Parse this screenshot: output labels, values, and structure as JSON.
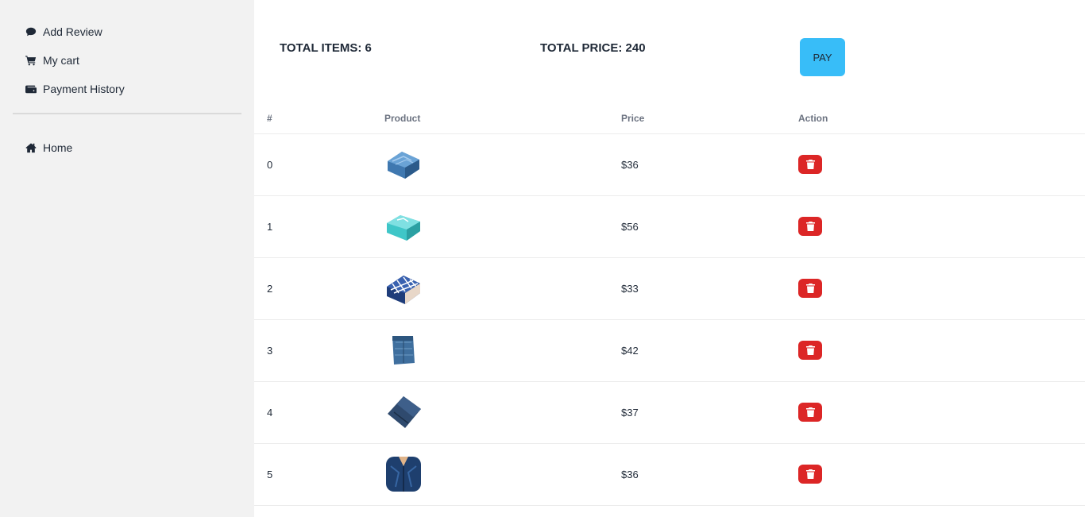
{
  "sidebar": {
    "primary": [
      {
        "label": "Add Review",
        "icon": "comment-icon"
      },
      {
        "label": "My cart",
        "icon": "cart-icon"
      },
      {
        "label": "Payment History",
        "icon": "wallet-icon"
      }
    ],
    "secondary": [
      {
        "label": "Home",
        "icon": "home-icon"
      }
    ]
  },
  "summary": {
    "total_items": "TOTAL ITEMS: 6",
    "total_price": "TOTAL PRICE: 240",
    "pay_label": "PAY"
  },
  "table": {
    "headers": [
      "#",
      "Product",
      "Price",
      "Action"
    ],
    "rows": [
      {
        "index": "0",
        "price": "$36",
        "image": "denim-shirt-folded"
      },
      {
        "index": "1",
        "price": "$56",
        "image": "aqua-shirt-folded"
      },
      {
        "index": "2",
        "price": "$33",
        "image": "checked-shirt-folded"
      },
      {
        "index": "3",
        "price": "$42",
        "image": "jeans-folded"
      },
      {
        "index": "4",
        "price": "$37",
        "image": "dark-shirt-folded"
      },
      {
        "index": "5",
        "price": "$36",
        "image": "denim-jacket"
      }
    ]
  },
  "colors": {
    "sidebar_bg": "#f2f2f2",
    "pay_button": "#38bdf8",
    "delete_button": "#dc2626"
  }
}
